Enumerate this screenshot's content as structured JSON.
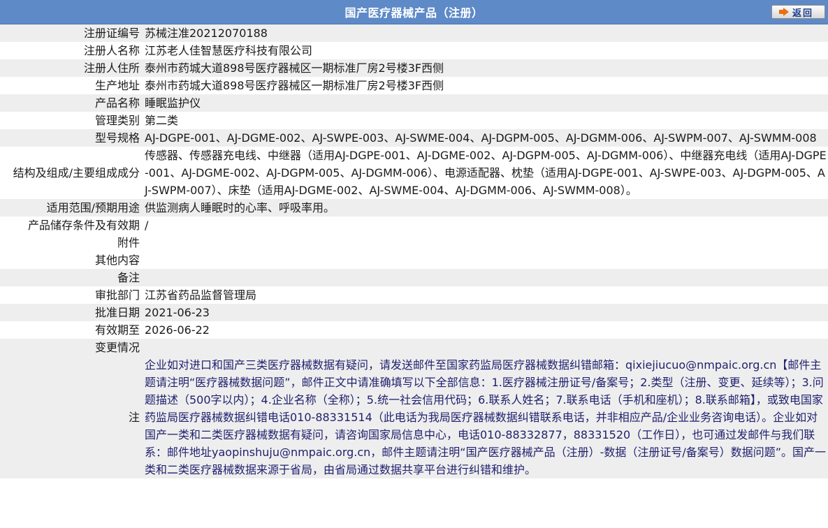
{
  "header": {
    "title": "国产医疗器械产品（注册）",
    "back_label": "返回"
  },
  "rows": [
    {
      "key": "注册证编号",
      "value": "苏械注准20212070188"
    },
    {
      "key": "注册人名称",
      "value": "江苏老人佳智慧医疗科技有限公司"
    },
    {
      "key": "注册人住所",
      "value": "泰州市药城大道898号医疗器械区一期标准厂房2号楼3F西侧"
    },
    {
      "key": "生产地址",
      "value": "泰州市药城大道898号医疗器械区一期标准厂房2号楼3F西侧"
    },
    {
      "key": "产品名称",
      "value": "睡眠监护仪"
    },
    {
      "key": "管理类别",
      "value": "第二类"
    },
    {
      "key": "型号规格",
      "value": "AJ-DGPE-001、AJ-DGME-002、AJ-SWPE-003、AJ-SWME-004、AJ-DGPM-005、AJ-DGMM-006、AJ-SWPM-007、AJ-SWMM-008"
    },
    {
      "key": "结构及组成/主要组成成分",
      "value": "传感器、传感器充电线、中继器（适用AJ-DGPE-001、AJ-DGME-002、AJ-DGPM-005、AJ-DGMM-006）、中继器充电线（适用AJ-DGPE-001、AJ-DGME-002、AJ-DGPM-005、AJ-DGMM-006）、电源适配器、枕垫（适用AJ-DGPE-001、AJ-SWPE-003、AJ-DGPM-005、AJ-SWPM-007）、床垫（适用AJ-DGME-002、AJ-SWME-004、AJ-DGMM-006、AJ-SWMM-008）。"
    },
    {
      "key": "适用范围/预期用途",
      "value": "供监测病人睡眠时的心率、呼吸率用。"
    },
    {
      "key": "产品储存条件及有效期",
      "value": "/"
    },
    {
      "key": "附件",
      "value": ""
    },
    {
      "key": "其他内容",
      "value": ""
    },
    {
      "key": "备注",
      "value": ""
    },
    {
      "key": "审批部门",
      "value": "江苏省药品监督管理局"
    },
    {
      "key": "批准日期",
      "value": "2021-06-23"
    },
    {
      "key": "有效期至",
      "value": "2026-06-22"
    },
    {
      "key": "变更情况",
      "value": ""
    }
  ],
  "note": {
    "key": "注",
    "value": "企业如对进口和国产三类医疗器械数据有疑问，请发送邮件至国家药监局医疗器械数据纠错邮箱：qixiejiucuo@nmpaic.org.cn【邮件主题请注明“医疗器械数据问题”，邮件正文中请准确填写以下全部信息：1.医疗器械注册证号/备案号；2.类型（注册、变更、延续等）；3.问题描述（500字以内）；4.企业名称（全称）；5.统一社会信用代码；6.联系人姓名；7.联系电话（手机和座机）；8.联系邮箱】，或致电国家药监局医疗器械数据纠错电话010-88331514（此电话为我局医疗器械数据纠错联系电话，并非相应产品/企业业务咨询电话）。企业如对国产一类和二类医疗器械数据有疑问，请咨询国家局信息中心，电话010-88332877，88331520（工作日），也可通过发邮件与我们联系：邮件地址yaopinshuju@nmpaic.org.cn，邮件主题请注明“国产医疗器械产品（注册）-数据（注册证号/备案号）数据问题”。国产一类和二类医疗器械数据来源于省局，由省局通过数据共享平台进行纠错和维护。"
  }
}
